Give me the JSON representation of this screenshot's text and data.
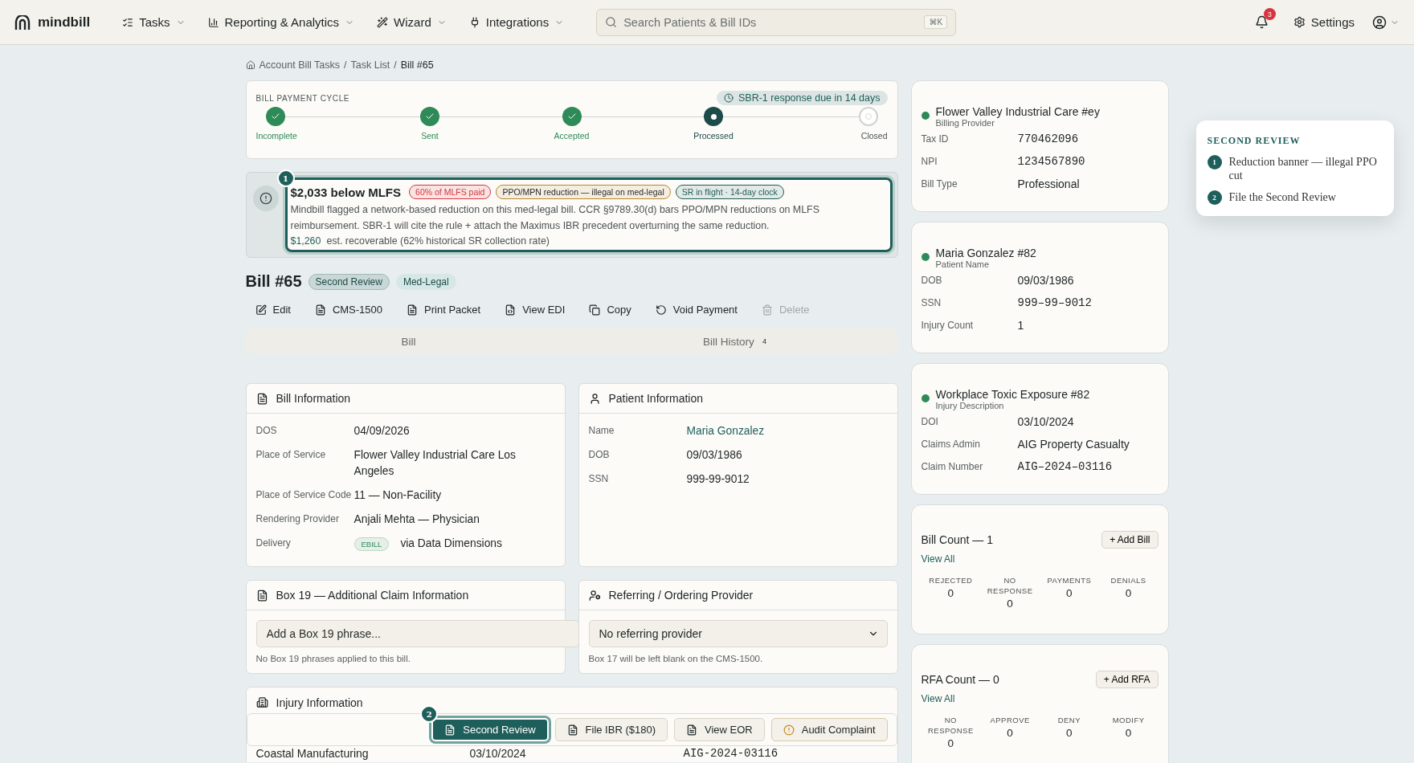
{
  "nav": {
    "logo": "mindbill",
    "menus": [
      {
        "label": "Tasks"
      },
      {
        "label": "Reporting & Analytics"
      },
      {
        "label": "Wizard"
      },
      {
        "label": "Integrations"
      }
    ],
    "search": {
      "placeholder": "Search Patients & Bill IDs",
      "shortcut": "⌘K"
    },
    "notifications": "3",
    "settings": "Settings"
  },
  "breadcrumb": {
    "items": [
      "Account Bill Tasks",
      "Task List",
      "Bill #65"
    ],
    "separator": "/"
  },
  "cycle": {
    "title": "BILL PAYMENT CYCLE",
    "due": "SBR-1 response due in 14 days",
    "steps": [
      {
        "label": "Incomplete",
        "kind": "done"
      },
      {
        "label": "Sent",
        "kind": "done"
      },
      {
        "label": "Accepted",
        "kind": "done"
      },
      {
        "label": "Processed",
        "kind": "current"
      },
      {
        "label": "Closed",
        "kind": "pending"
      }
    ]
  },
  "banner": {
    "marker": "1",
    "title": "$2,033 below MLFS",
    "tags": [
      {
        "label": "60% of MLFS paid",
        "color": "#d8343f"
      },
      {
        "label": "PPO/MPN reduction — illegal on med-legal",
        "color": "#b9862e"
      },
      {
        "label": "SR in flight · 14-day clock",
        "color": "#1f5f5b"
      }
    ],
    "body": "Mindbill flagged a network-based reduction on this med-legal bill. CCR §9789.30(d) bars PPO/MPN reductions on MLFS reimbursement. SBR-1 will cite the rule + attach the Maximus IBR precedent overturning the same reduction.",
    "amount": "$1,260",
    "amount_note": "est. recoverable (62% historical SR collection rate)"
  },
  "bill": {
    "title": "Bill #65",
    "tags": [
      {
        "label": "Second Review",
        "color": "#c9d8d6"
      },
      {
        "label": "Med-Legal",
        "color": "#d6e8e5"
      }
    ],
    "actions": [
      {
        "label": "Edit",
        "disabled": false
      },
      {
        "label": "CMS-1500",
        "disabled": false
      },
      {
        "label": "Print Packet",
        "disabled": false
      },
      {
        "label": "View EDI",
        "disabled": false
      },
      {
        "label": "Copy",
        "disabled": false
      },
      {
        "label": "Void Payment",
        "disabled": false
      },
      {
        "label": "Delete",
        "disabled": true
      }
    ],
    "tabs": [
      {
        "label": "Bill"
      },
      {
        "label": "Bill History",
        "count": "4"
      }
    ]
  },
  "bill_information": {
    "title": "Bill Information",
    "rows": [
      {
        "label": "DOS",
        "value": "04/09/2026"
      },
      {
        "label": "Place of Service",
        "value": "Flower Valley Industrial Care Los Angeles"
      },
      {
        "label": "Place of Service Code",
        "value": "11 — Non-Facility"
      },
      {
        "label": "Rendering Provider",
        "value": "Anjali Mehta — Physician"
      },
      {
        "label": "Delivery",
        "badge": "EBILL",
        "value": "via Data Dimensions"
      }
    ]
  },
  "patient_information": {
    "title": "Patient Information",
    "rows": [
      {
        "label": "Name",
        "value": "Maria Gonzalez",
        "link": true
      },
      {
        "label": "DOB",
        "value": "09/03/1986",
        "link": false
      },
      {
        "label": "SSN",
        "value": "999-99-9012",
        "link": false
      }
    ]
  },
  "box19": {
    "title": "Box 19 — Additional Claim Information",
    "placeholder": "Add a Box 19 phrase...",
    "note": "No Box 19 phrases applied to this bill."
  },
  "referring": {
    "title": "Referring / Ordering Provider",
    "value": "No referring provider",
    "note": "Box 17 will be left blank on the CMS-1500."
  },
  "injury": {
    "title": "Injury Information",
    "row": [
      "Coastal Manufacturing",
      "03/10/2024",
      "AIG-2024-03116"
    ]
  },
  "action_bar": {
    "marker": "2",
    "buttons": [
      {
        "label": "Second Review",
        "kind": "primary"
      },
      {
        "label": "File IBR ($180)",
        "kind": "default"
      },
      {
        "label": "View EOR",
        "kind": "default"
      },
      {
        "label": "Audit Complaint",
        "kind": "warning"
      }
    ]
  },
  "entities": [
    {
      "title": "Flower Valley Industrial Care #ey",
      "subtitle": "Billing Provider",
      "color": "#2e8b57",
      "rows": [
        {
          "label": "Tax ID",
          "value": "770462096",
          "mono": true
        },
        {
          "label": "NPI",
          "value": "1234567890",
          "mono": true
        },
        {
          "label": "Bill Type",
          "value": "Professional",
          "mono": false
        }
      ]
    },
    {
      "title": "Maria Gonzalez #82",
      "subtitle": "Patient Name",
      "color": "#2e8b57",
      "rows": [
        {
          "label": "DOB",
          "value": "09/03/1986",
          "mono": false
        },
        {
          "label": "SSN",
          "value": "999–99–9012",
          "mono": true
        },
        {
          "label": "Injury Count",
          "value": "1",
          "mono": false
        }
      ]
    },
    {
      "title": "Workplace Toxic Exposure #82",
      "subtitle": "Injury Description",
      "color": "#2e8b57",
      "rows": [
        {
          "label": "DOI",
          "value": "03/10/2024",
          "mono": false
        },
        {
          "label": "Claims Admin",
          "value": "AIG Property Casualty",
          "mono": false
        },
        {
          "label": "Claim Number",
          "value": "AIG–2024–03116",
          "mono": true
        }
      ]
    }
  ],
  "counts": [
    {
      "title": "Bill Count — 1",
      "add": "+ Add Bill",
      "link": "View All",
      "stats": [
        {
          "label": "REJECTED",
          "value": "0"
        },
        {
          "label": "NO RESPONSE",
          "value": "0"
        },
        {
          "label": "PAYMENTS",
          "value": "0"
        },
        {
          "label": "DENIALS",
          "value": "0"
        }
      ]
    },
    {
      "title": "RFA Count — 0",
      "add": "+ Add RFA",
      "link": "View All",
      "stats": [
        {
          "label": "NO RESPONSE",
          "value": "0"
        },
        {
          "label": "APPROVE",
          "value": "0"
        },
        {
          "label": "DENY",
          "value": "0"
        },
        {
          "label": "MODIFY",
          "value": "0"
        }
      ]
    }
  ],
  "tour": {
    "title": "SECOND REVIEW",
    "steps": [
      {
        "number": "1",
        "text": "Reduction banner — illegal PPO cut"
      },
      {
        "number": "2",
        "text": "File the Second Review"
      }
    ]
  }
}
